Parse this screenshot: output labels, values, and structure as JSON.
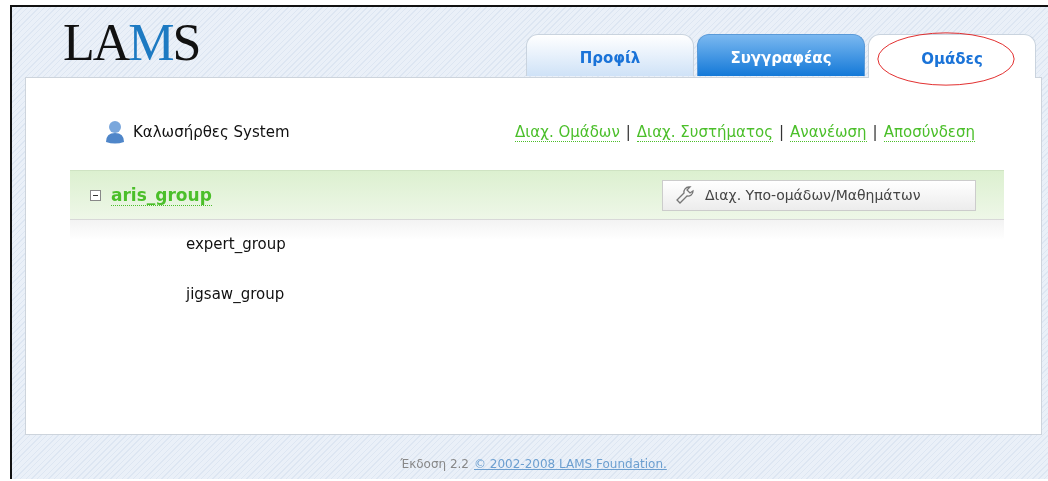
{
  "logo": {
    "text": "LAMS"
  },
  "tabs": [
    {
      "label": "Προφίλ",
      "selected": false,
      "highlighted": false
    },
    {
      "label": "Συγγραφέας",
      "selected": false,
      "highlighted": true
    },
    {
      "label": "Ομάδες",
      "selected": true,
      "highlighted": false
    }
  ],
  "greeting": "Καλωσήρθες System",
  "links": [
    "Διαχ. Ομάδων",
    "Διαχ. Συστήματος",
    "Ανανέωση",
    "Αποσύνδεση"
  ],
  "link_separator": "|",
  "group": {
    "name": "aris_group",
    "expanded": true,
    "button": "Διαχ. Υπο-ομάδων/Μαθημάτων",
    "children": [
      {
        "name": "expert_group"
      },
      {
        "name": "jigsaw_group"
      }
    ]
  },
  "footer": {
    "version": "Έκδοση 2.2",
    "link": "© 2002-2008 LAMS Foundation."
  }
}
